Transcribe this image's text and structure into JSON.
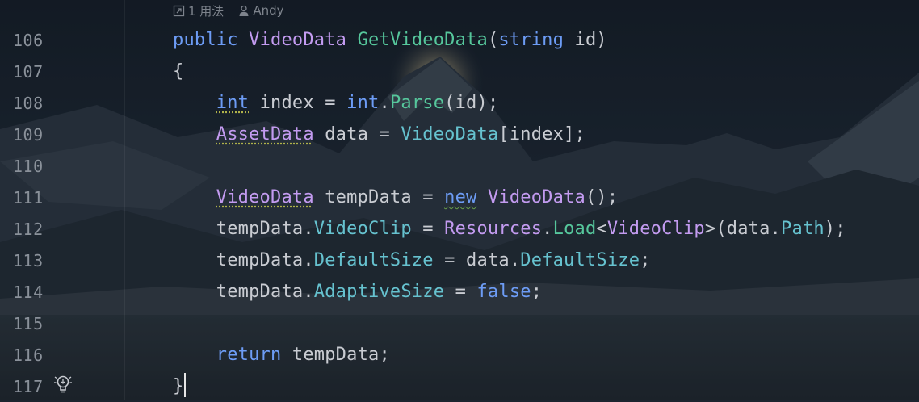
{
  "editor": {
    "hint": {
      "usages": "1 用法",
      "author": "Andy"
    },
    "lines": [
      {
        "number": "106",
        "tokens": [
          {
            "t": "public",
            "c": "kw"
          },
          {
            "t": " ",
            "c": "pl"
          },
          {
            "t": "VideoData",
            "c": "ty"
          },
          {
            "t": " ",
            "c": "pl"
          },
          {
            "t": "GetVideoData",
            "c": "mt"
          },
          {
            "t": "(",
            "c": "pl"
          },
          {
            "t": "string",
            "c": "kw"
          },
          {
            "t": " id)",
            "c": "pl"
          }
        ]
      },
      {
        "number": "107",
        "tokens": [
          {
            "t": "{",
            "c": "pl"
          }
        ]
      },
      {
        "number": "108",
        "tokens": [
          {
            "t": "    ",
            "c": "pl"
          },
          {
            "t": "int",
            "c": "kw",
            "u": "warn"
          },
          {
            "t": " index = ",
            "c": "pl"
          },
          {
            "t": "int",
            "c": "kw"
          },
          {
            "t": ".",
            "c": "pl"
          },
          {
            "t": "Parse",
            "c": "mt"
          },
          {
            "t": "(id);",
            "c": "pl"
          }
        ]
      },
      {
        "number": "109",
        "tokens": [
          {
            "t": "    ",
            "c": "pl"
          },
          {
            "t": "AssetData",
            "c": "ty",
            "u": "warn"
          },
          {
            "t": " data = ",
            "c": "pl"
          },
          {
            "t": "VideoData",
            "c": "pr"
          },
          {
            "t": "[index];",
            "c": "pl"
          }
        ]
      },
      {
        "number": "110",
        "tokens": []
      },
      {
        "number": "111",
        "tokens": [
          {
            "t": "    ",
            "c": "pl"
          },
          {
            "t": "VideoData",
            "c": "ty",
            "u": "warn"
          },
          {
            "t": " tempData = ",
            "c": "pl"
          },
          {
            "t": "new",
            "c": "kw",
            "u": "wavy"
          },
          {
            "t": " ",
            "c": "pl"
          },
          {
            "t": "VideoData",
            "c": "ty"
          },
          {
            "t": "();",
            "c": "pl"
          }
        ]
      },
      {
        "number": "112",
        "tokens": [
          {
            "t": "    tempData.",
            "c": "pl"
          },
          {
            "t": "VideoClip",
            "c": "pr"
          },
          {
            "t": " = ",
            "c": "pl"
          },
          {
            "t": "Resources",
            "c": "ty"
          },
          {
            "t": ".",
            "c": "pl"
          },
          {
            "t": "Load",
            "c": "mt"
          },
          {
            "t": "<",
            "c": "pl"
          },
          {
            "t": "VideoClip",
            "c": "ty"
          },
          {
            "t": ">(data.",
            "c": "pl"
          },
          {
            "t": "Path",
            "c": "pr"
          },
          {
            "t": ");",
            "c": "pl"
          }
        ]
      },
      {
        "number": "113",
        "tokens": [
          {
            "t": "    tempData.",
            "c": "pl"
          },
          {
            "t": "DefaultSize",
            "c": "pr"
          },
          {
            "t": " = data.",
            "c": "pl"
          },
          {
            "t": "DefaultSize",
            "c": "pr"
          },
          {
            "t": ";",
            "c": "pl"
          }
        ]
      },
      {
        "number": "114",
        "tokens": [
          {
            "t": "    tempData.",
            "c": "pl"
          },
          {
            "t": "AdaptiveSize",
            "c": "pr"
          },
          {
            "t": " = ",
            "c": "pl"
          },
          {
            "t": "false",
            "c": "kw"
          },
          {
            "t": ";",
            "c": "pl"
          }
        ]
      },
      {
        "number": "115",
        "tokens": []
      },
      {
        "number": "116",
        "tokens": [
          {
            "t": "    ",
            "c": "pl"
          },
          {
            "t": "return",
            "c": "kw"
          },
          {
            "t": " tempData;",
            "c": "pl"
          }
        ]
      },
      {
        "number": "117",
        "tokens": [
          {
            "t": "}",
            "c": "pl"
          }
        ],
        "caret": true
      }
    ]
  },
  "icons": {
    "usages": "usages-link-icon",
    "author": "person-icon",
    "intention": "lightbulb-icon"
  }
}
